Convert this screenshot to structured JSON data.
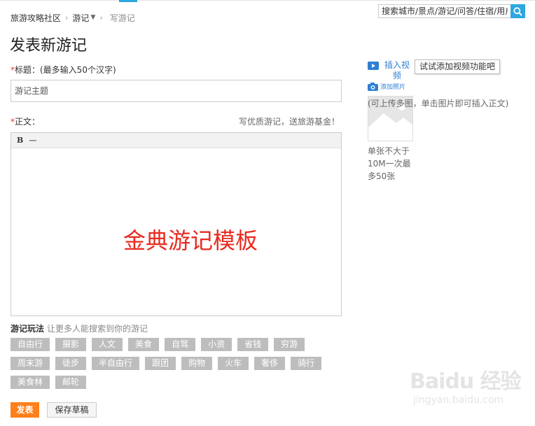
{
  "breadcrumb": {
    "community": "旅游攻略社区",
    "section": "游记",
    "current": "写游记"
  },
  "search": {
    "placeholder": "搜索城市/景点/游记/问答/住宿/用户"
  },
  "page_title": "发表新游记",
  "form": {
    "required_mark": "*",
    "title_label": "标题：(最多输入50个汉字)",
    "title_placeholder": "游记主题",
    "body_label": "正文：",
    "body_hint": "写优质游记，送旅游基金！",
    "toolbar": {
      "bold": "B",
      "line": "一"
    },
    "editor_overlay": "金典游记模板"
  },
  "tags": {
    "title": "游记玩法",
    "subtitle": "让更多人能搜索到你的游记",
    "rows": [
      [
        "自由行",
        "摄影",
        "人文",
        "美食",
        "自驾",
        "小资",
        "省钱",
        "穷游"
      ],
      [
        "周末游",
        "徒步",
        "半自由行",
        "跟团",
        "购物",
        "火车",
        "奢侈",
        "骑行"
      ],
      [
        "美食林",
        "邮轮"
      ]
    ]
  },
  "actions": {
    "publish": "发表",
    "save_draft": "保存草稿"
  },
  "sidebar": {
    "video_label": "插入视频",
    "video_tooltip": "试试添加视频功能吧",
    "photo_label": "添加照片",
    "upload_hint": "(可上传多图，单击图片即可插入正文)",
    "size_hint": "单张不大于10M一次最多50张"
  },
  "watermark": {
    "logo": "Baidu 经验",
    "url": "jingyan.baidu.com"
  },
  "colors": {
    "accent_blue": "#2da7e0",
    "link_blue": "#2d7fd3",
    "required_red": "#e4393c",
    "overlay_red": "#e82a1f",
    "publish_orange": "#ff7f1a",
    "tag_gray": "#bdbdbd"
  },
  "icons": {
    "search": "search-icon",
    "video": "video-icon",
    "camera": "camera-icon",
    "image_placeholder": "image-placeholder-icon",
    "caret": "caret-down-icon"
  }
}
